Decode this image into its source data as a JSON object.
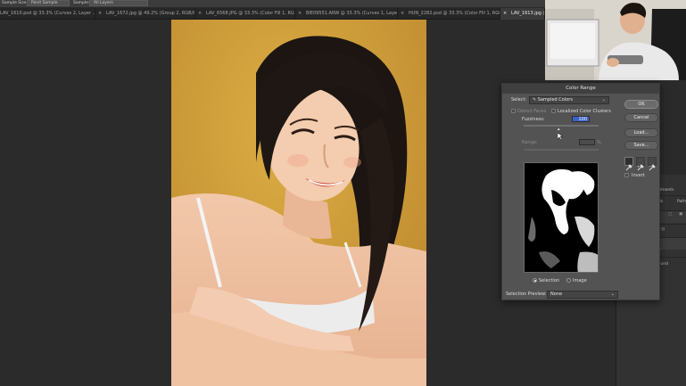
{
  "options_bar": {
    "sample_size_label": "Sample Size:",
    "sample_size_value": "Point Sample",
    "sample_label": "Sample:",
    "sample_value": "All Layers"
  },
  "tabs": [
    {
      "label": "LAV_1610.psd @ 33.3% (Curves 2, Layer ...",
      "active": false
    },
    {
      "label": "LAV_1672.jpg @ 49.2% (Group 2, RGB/8*...",
      "active": false
    },
    {
      "label": "LAV_6568.JPG @ 33.3% (Color Fill 1, RGB/...",
      "active": false
    },
    {
      "label": "BIE09551.ARW @ 33.3% (Curves 1, Layer ...",
      "active": false
    },
    {
      "label": "HUN_2282.psd @ 33.3% (Color Fill 1, RGB/...",
      "active": false
    },
    {
      "label": "LAV_1613.jpg @ 3...",
      "active": true
    }
  ],
  "dialog": {
    "title": "Color Range",
    "select_label": "Select:",
    "select_value": "Sampled Colors",
    "detect_faces": "Detect Faces",
    "localized_clusters": "Localized Color Clusters",
    "fuzziness_label": "Fuzziness:",
    "fuzziness_value": "100",
    "range_label": "Range:",
    "range_unit": "%",
    "buttons": {
      "ok": "OK",
      "cancel": "Cancel",
      "load": "Load...",
      "save": "Save..."
    },
    "invert": "Invert",
    "view_selection": "Selection",
    "view_image": "Image",
    "selection_preview_label": "Selection Preview:",
    "selection_preview_value": "None"
  },
  "right_panel": {
    "adjustments": "justments",
    "channels": "nnels",
    "paths": "Path",
    "layer_1": "r 1",
    "background": "ground"
  },
  "colors": {
    "accent": "#3b62c7",
    "dialog_bg": "#535353",
    "workspace_bg": "#2b2b2b",
    "photo_backdrop": "#d4a033"
  }
}
